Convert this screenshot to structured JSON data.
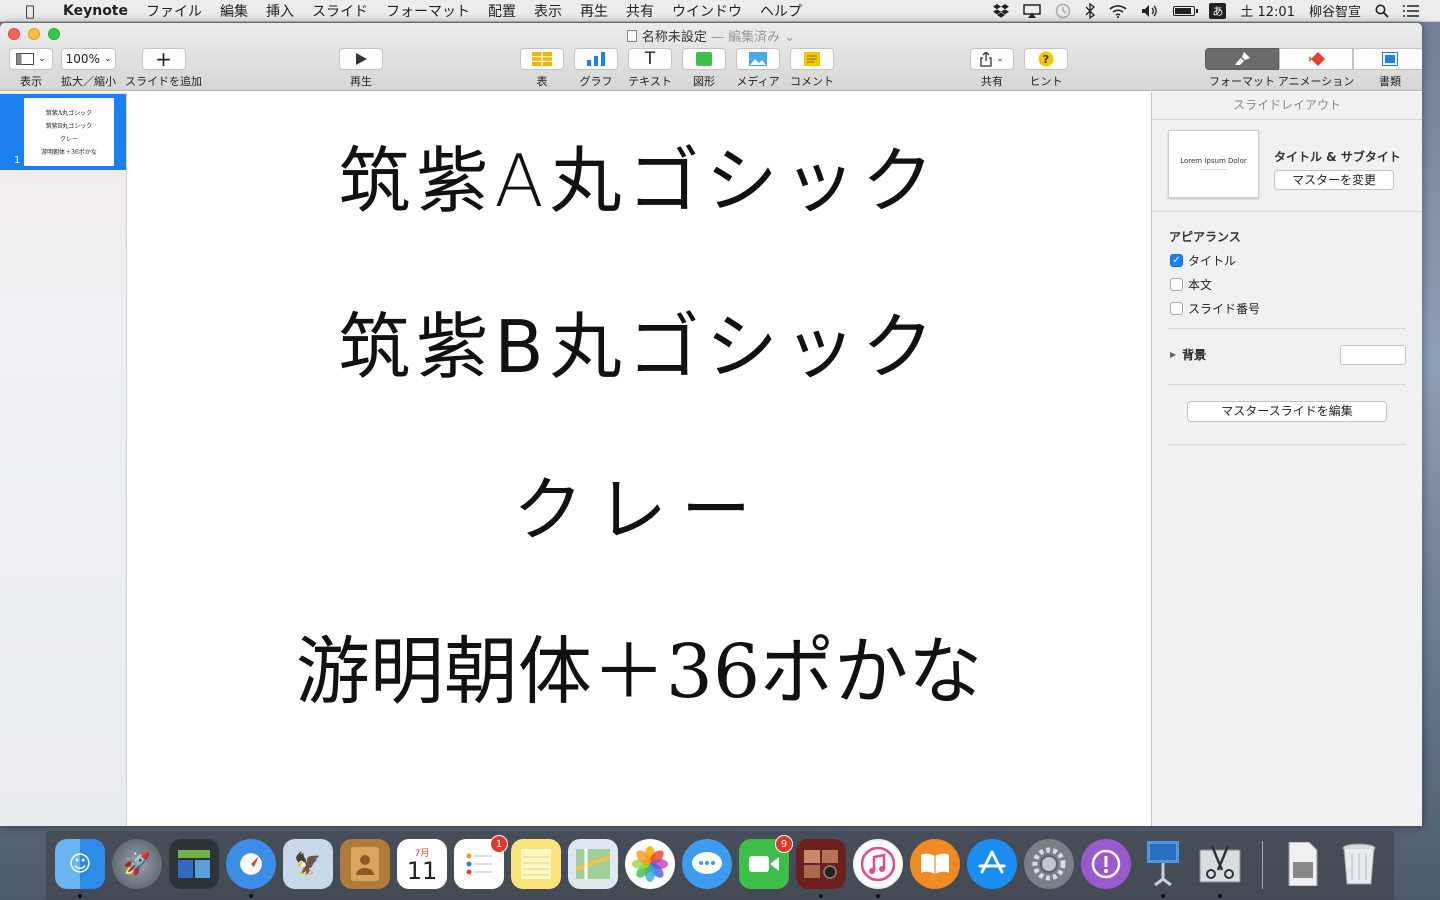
{
  "menubar": {
    "apple": "",
    "app": "Keynote",
    "items": [
      "ファイル",
      "編集",
      "挿入",
      "スライド",
      "フォーマット",
      "配置",
      "表示",
      "再生",
      "共有",
      "ウインドウ",
      "ヘルプ"
    ],
    "ime": "あ",
    "clock": "土 12:01",
    "user": "柳谷智宣"
  },
  "window": {
    "doc_title": "名称未設定",
    "doc_status": "— 編集済み",
    "toolbar": {
      "view": "表示",
      "zoom_value": "100%",
      "zoom": "拡大／縮小",
      "add_slide": "スライドを追加",
      "play": "再生",
      "table": "表",
      "chart": "グラフ",
      "text": "テキスト",
      "shape": "図形",
      "media": "メディア",
      "comment": "コメント",
      "share": "共有",
      "tips": "ヒント",
      "format": "フォーマット",
      "animate": "アニメーション",
      "document": "書類"
    }
  },
  "navigator": {
    "slide_number": "1",
    "thumb_lines": [
      "筑紫A丸ゴシック",
      "筑紫B丸ゴシック",
      "クレー",
      "游明朝体＋36ポかな"
    ]
  },
  "slide": {
    "lines": [
      "筑紫A丸ゴシック",
      "筑紫B丸ゴシック",
      "クレー",
      "游明朝体＋36ポかな"
    ]
  },
  "inspector": {
    "header": "スライドレイアウト",
    "layout_thumb_title": "Lorem Ipsum Dolor",
    "layout_name": "タイトル & サブタイト",
    "change_master": "マスターを変更",
    "appearance": "アピアランス",
    "checks": [
      {
        "label": "タイトル",
        "checked": true
      },
      {
        "label": "本文",
        "checked": false
      },
      {
        "label": "スライド番号",
        "checked": false
      }
    ],
    "background": "背景",
    "edit_master": "マスタースライドを編集"
  },
  "dock": {
    "calendar_month": "7月",
    "calendar_day": "11",
    "reminders_badge": "1",
    "facetime_badge": "9"
  },
  "colors": {
    "accent": "#1c7ff2",
    "format_active": "#6b6b6b"
  }
}
